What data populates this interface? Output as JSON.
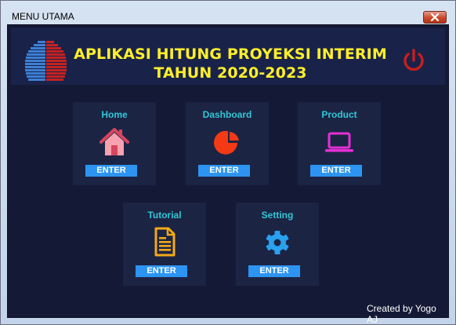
{
  "window": {
    "title": "MENU UTAMA"
  },
  "header": {
    "title_line1": "APLIKASI HITUNG PROYEKSI INTERIM",
    "title_line2": "TAHUN 2020-2023"
  },
  "menu": [
    {
      "label": "Home",
      "button": "ENTER",
      "icon": "house-icon",
      "color": "#f48fa0"
    },
    {
      "label": "Dashboard",
      "button": "ENTER",
      "icon": "pie-chart-icon",
      "color": "#f43a14"
    },
    {
      "label": "Product",
      "button": "ENTER",
      "icon": "laptop-icon",
      "color": "#e62fd6"
    },
    {
      "label": "Tutorial",
      "button": "ENTER",
      "icon": "document-icon",
      "color": "#f2a916"
    },
    {
      "label": "Setting",
      "button": "ENTER",
      "icon": "gear-icon",
      "color": "#2aa1ee"
    }
  ],
  "footer": {
    "credit": "Created by Yogo AJ"
  },
  "colors": {
    "accent_title": "#ffef2a",
    "label": "#31c7d6",
    "button": "#2d94f2",
    "power": "#c81e1e"
  }
}
